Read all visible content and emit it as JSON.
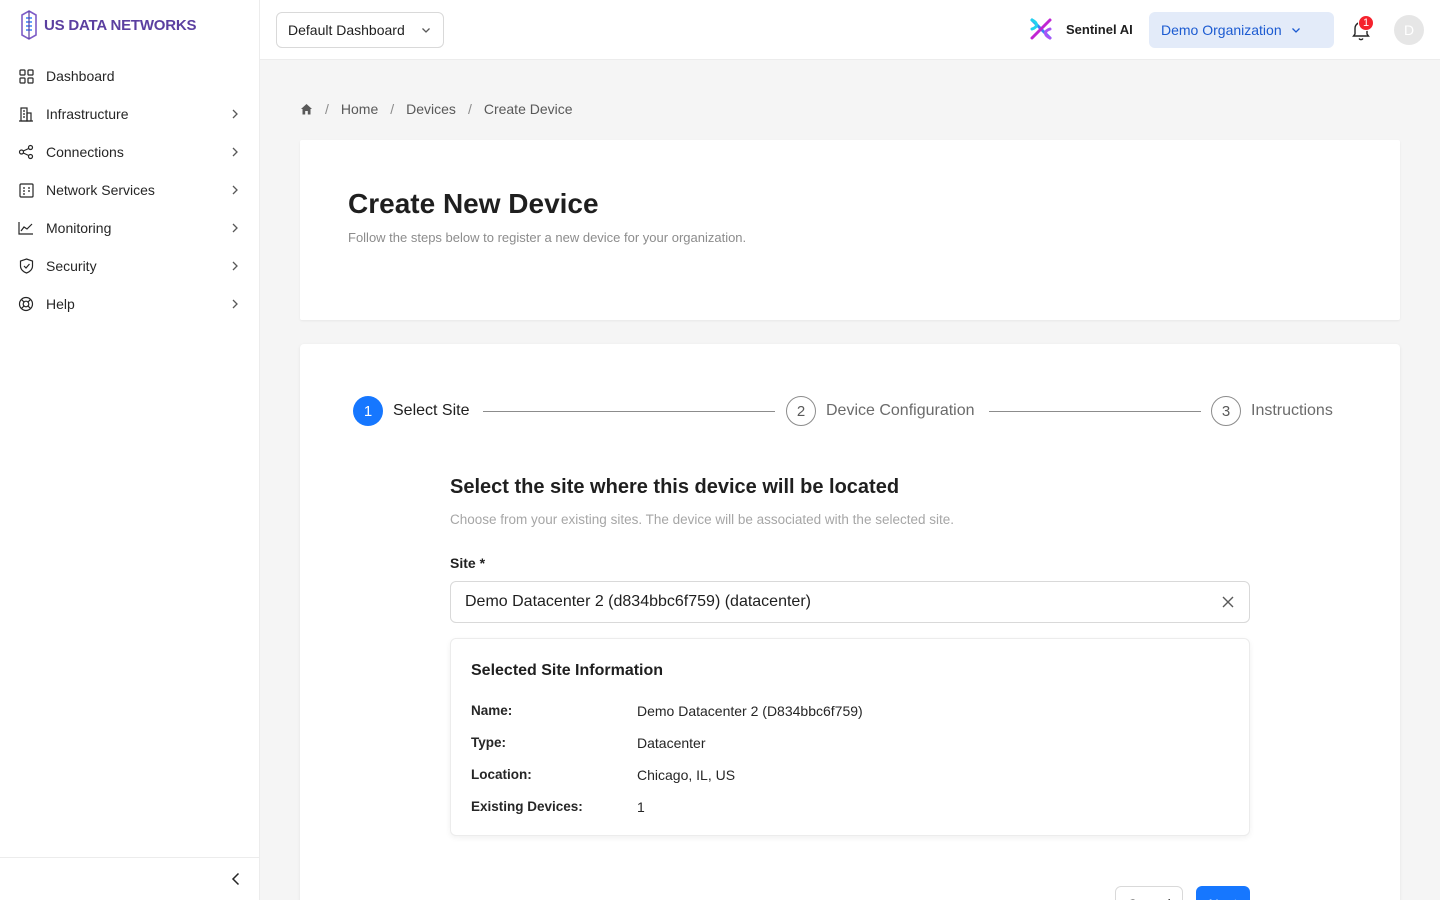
{
  "brand": {
    "name": "US DATA NETWORKS"
  },
  "sidebar": {
    "items": [
      {
        "label": "Dashboard",
        "icon": "grid-icon"
      },
      {
        "label": "Infrastructure",
        "icon": "building-icon"
      },
      {
        "label": "Connections",
        "icon": "share-icon"
      },
      {
        "label": "Network Services",
        "icon": "network-icon"
      },
      {
        "label": "Monitoring",
        "icon": "line-chart-icon"
      },
      {
        "label": "Security",
        "icon": "shield-icon"
      },
      {
        "label": "Help",
        "icon": "lifebuoy-icon"
      }
    ]
  },
  "header": {
    "dashboard_select": "Default Dashboard",
    "sentinel_label": "Sentinel AI",
    "org_select": "Demo Organization",
    "notification_count": "1",
    "avatar_initial": "D"
  },
  "breadcrumb": {
    "home": "Home",
    "devices": "Devices",
    "current": "Create Device"
  },
  "page": {
    "title": "Create New Device",
    "subtitle": "Follow the steps below to register a new device for your organization."
  },
  "steps": [
    {
      "number": "1",
      "label": "Select Site",
      "status": "active"
    },
    {
      "number": "2",
      "label": "Device Configuration",
      "status": "wait"
    },
    {
      "number": "3",
      "label": "Instructions",
      "status": "wait"
    }
  ],
  "form": {
    "section_title": "Select the site where this device will be located",
    "section_subtitle": "Choose from your existing sites. The device will be associated with the selected site.",
    "site_label": "Site *",
    "site_value": "Demo Datacenter 2 (d834bbc6f759) (datacenter)"
  },
  "site_info": {
    "title": "Selected Site Information",
    "rows": [
      {
        "key": "Name:",
        "value": "Demo Datacenter 2 (D834bbc6f759)"
      },
      {
        "key": "Type:",
        "value": "Datacenter"
      },
      {
        "key": "Location:",
        "value": "Chicago, IL, US"
      },
      {
        "key": "Existing Devices:",
        "value": "1"
      }
    ]
  },
  "actions": {
    "cancel": "Cancel",
    "next": "Next"
  },
  "colors": {
    "primary": "#1677ff",
    "brand": "#5b3fa0",
    "org_bg": "#e3ebf9",
    "badge": "#f5222d"
  }
}
